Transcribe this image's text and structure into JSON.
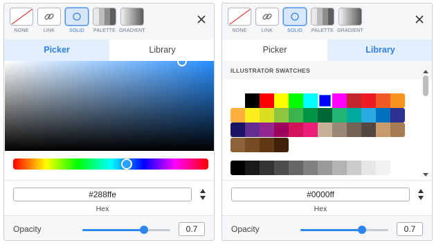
{
  "fill_types": [
    "NONE",
    "LINK",
    "SOLID",
    "PALETTE",
    "GRADIENT"
  ],
  "tabs": [
    "Picker",
    "Library"
  ],
  "left": {
    "active_fill": "SOLID",
    "active_tab": "Picker",
    "hex_value": "#288ffe",
    "hex_label": "Hex",
    "opacity_label": "Opacity",
    "opacity_value": "0.7",
    "opacity_fraction": 0.7,
    "hue_fraction": 0.58,
    "current_color": "#288ffe"
  },
  "right": {
    "active_fill": "SOLID",
    "active_tab": "Library",
    "library_header": "ILLUSTRATOR SWATCHES",
    "swatch_rows": [
      [
        "#ffffff",
        "#000000",
        "#ff0000",
        "#ffff00",
        "#00ff00",
        "#00ffff",
        "#0000ff",
        "#ff00ff",
        "#c1272d",
        "#ed1c24",
        "#f15a24",
        "#f7931e"
      ],
      [
        "#fbb03b",
        "#fcee21",
        "#d9e021",
        "#8cc63f",
        "#39b54a",
        "#009245",
        "#006837",
        "#22b573",
        "#00a99d",
        "#29abe2",
        "#0071bc",
        "#2e3192"
      ],
      [
        "#1b1464",
        "#662d91",
        "#93278f",
        "#9e005d",
        "#d4145a",
        "#ed1e79",
        "#c7b299",
        "#998675",
        "#736357",
        "#534741",
        "#c69c6d",
        "#a67c52"
      ],
      [
        "#8c6239",
        "#754c24",
        "#603813",
        "#42210b"
      ],
      [
        "#000000",
        "#1a1a1a",
        "#333333",
        "#4d4d4d",
        "#666666",
        "#808080",
        "#999999",
        "#b3b3b3",
        "#cccccc",
        "#e6e6e6",
        "#f2f2f2"
      ]
    ],
    "selected_swatch": "#0000ff",
    "hex_value": "#0000ff",
    "hex_label": "Hex",
    "opacity_label": "Opacity",
    "opacity_value": "0.7",
    "opacity_fraction": 0.7
  },
  "icons": {
    "none": "none-fill-icon",
    "link": "link-icon",
    "solid": "circle-icon",
    "palette": "palette-icon",
    "gradient": "gradient-icon",
    "close": "close-icon"
  },
  "colors": {
    "accent": "#2f7fe6",
    "active_tab_bg": "#e3effc"
  }
}
